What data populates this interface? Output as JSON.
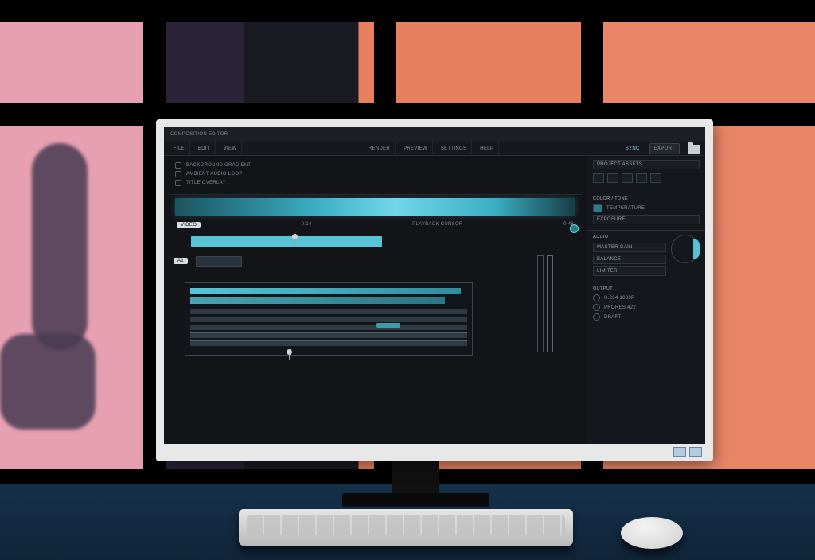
{
  "app": {
    "title": "COMPOSITION EDITOR"
  },
  "menu": {
    "left": [
      "FILE",
      "EDIT",
      "VIEW"
    ],
    "mid": [
      "RENDER",
      "PREVIEW",
      "SETTINGS",
      "HELP"
    ],
    "right_accent": "SYNC",
    "right_box": "EXPORT"
  },
  "layers": [
    "BACKGROUND GRADIENT",
    "AMBIENT AUDIO LOOP",
    "TITLE OVERLAY"
  ],
  "timeline": {
    "track1_label": "VIDEO",
    "track2_label": "A1",
    "mid_left_label": "0:14",
    "mid_center_label": "PLAYBACK CURSOR",
    "mid_right_label": "0:48"
  },
  "panel": {
    "search_label": "PROJECT ASSETS",
    "section1_title": "COLOR / TONE",
    "section1_items": [
      "TEMPERATURE",
      "EXPOSURE"
    ],
    "section2_title": "AUDIO",
    "section2_items": [
      "MASTER GAIN",
      "BALANCE",
      "LIMITER"
    ],
    "section3_title": "OUTPUT",
    "section3_items": [
      "H.264 1080P",
      "PRORES 422",
      "DRAFT"
    ]
  },
  "colors": {
    "accent": "#57c4d8",
    "panel": "#14171b",
    "screen": "#121418"
  }
}
